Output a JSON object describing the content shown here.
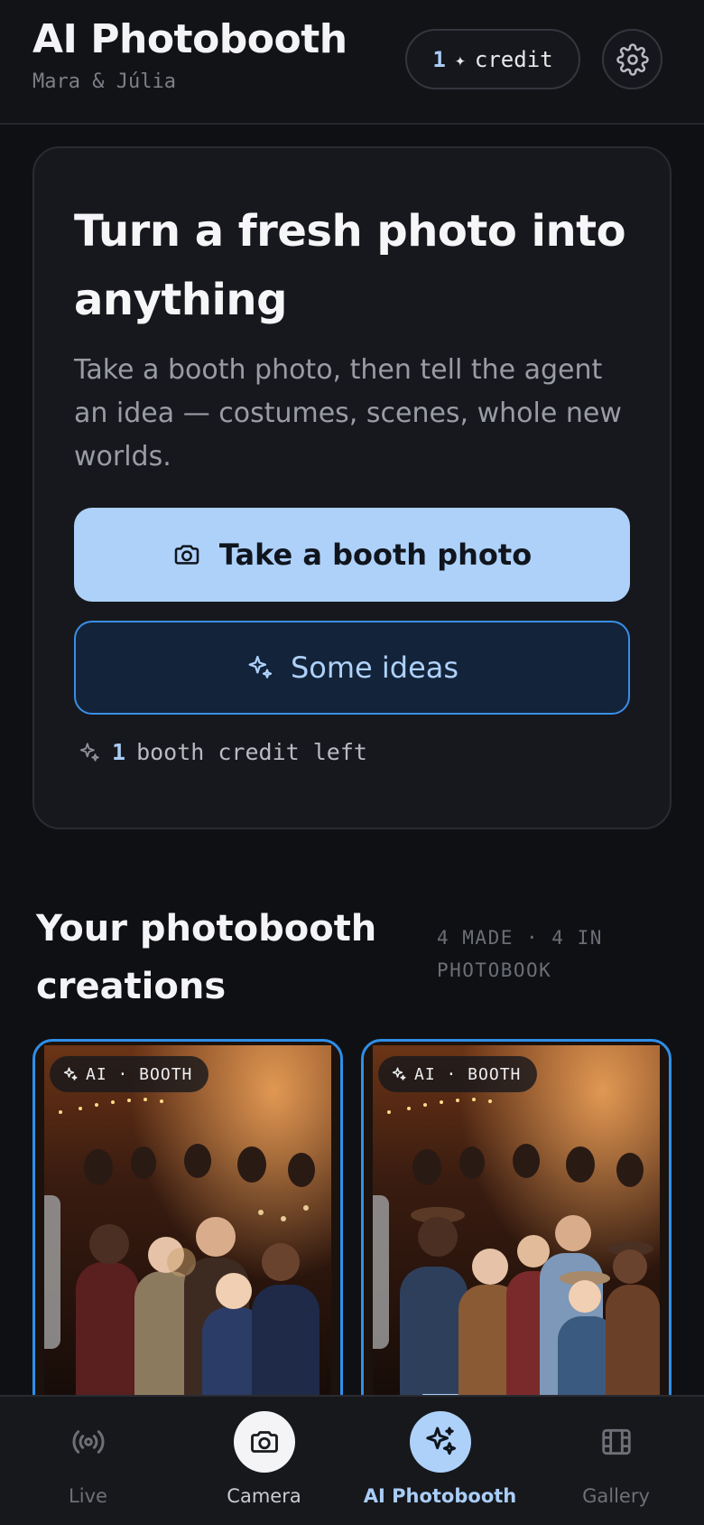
{
  "header": {
    "title": "AI Photobooth",
    "subtitle": "Mara & Júlia",
    "credit_count": "1",
    "credit_star": "✦",
    "credit_label": "credit"
  },
  "hero": {
    "title": "Turn a fresh photo into anything",
    "description": "Take a booth photo, then tell the agent an idea — costumes, scenes, whole new worlds.",
    "primary_button": "Take a booth photo",
    "secondary_button": "Some ideas",
    "credits_count": "1",
    "credits_text": "booth credit left"
  },
  "creations": {
    "title": "Your photobooth creations",
    "meta": "4 MADE · 4 IN PHOTOBOOK",
    "items": [
      {
        "tag": "AI · BOOTH",
        "theme": "renaissance-costume-party"
      },
      {
        "tag": "AI · BOOTH",
        "theme": "western-costume-party"
      }
    ]
  },
  "nav": {
    "items": [
      {
        "label": "Live",
        "icon": "broadcast-icon"
      },
      {
        "label": "Camera",
        "icon": "camera-icon"
      },
      {
        "label": "AI Photobooth",
        "icon": "sparkles-icon",
        "active": true
      },
      {
        "label": "Gallery",
        "icon": "gallery-icon"
      }
    ]
  },
  "colors": {
    "accent": "#aed1fa",
    "accent_border": "#2f8fe8",
    "background": "#0f1014",
    "card": "#17181d"
  }
}
